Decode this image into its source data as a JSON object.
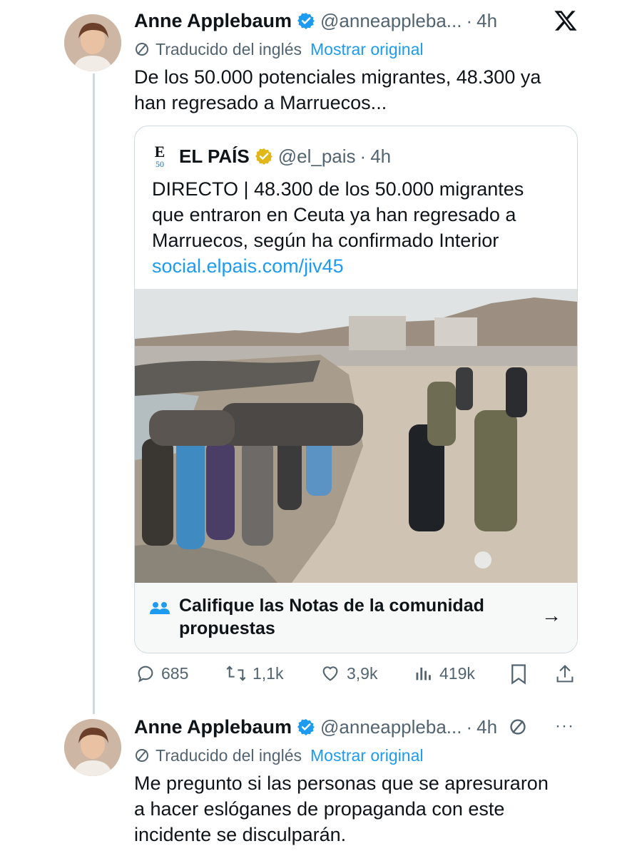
{
  "tweet1": {
    "author_name": "Anne Applebaum",
    "handle": "@anneappleba...",
    "separator": "·",
    "time": "4h",
    "translated_label": "Traducido del inglés",
    "show_original": "Mostrar original",
    "text_line1": "De los 50.000 potenciales migrantes, 48.300 ya",
    "text_line2": "han regresado a Marruecos...",
    "quote": {
      "logo_text": "E",
      "logo_sub": "50",
      "name": "EL PAÍS",
      "handle": "@el_pais",
      "separator": "·",
      "time": "4h",
      "text_line1": "DIRECTO | 48.300 de los 50.000 migrantes",
      "text_line2": "que entraron en Ceuta ya han regresado a",
      "text_line3": "Marruecos, según ha confirmado Interior",
      "link": "social.elpais.com/jiv45"
    },
    "community_notes": {
      "line1": "Califique las Notas de la comunidad",
      "line2": "propuestas",
      "arrow": "→"
    },
    "actions": {
      "replies": "685",
      "reposts": "1,1k",
      "likes": "3,9k",
      "views": "419k"
    }
  },
  "tweet2": {
    "author_name": "Anne Applebaum",
    "handle": "@anneappleba...",
    "separator": "·",
    "time": "4h",
    "more": "···",
    "translated_label": "Traducido del inglés",
    "show_original": "Mostrar original",
    "text_line1": "Me pregunto si las personas que se apresuraron",
    "text_line2": "a hacer eslóganes de propaganda con este",
    "text_line3": "incidente se disculparán."
  },
  "colors": {
    "accent_blue": "#1d9bf0",
    "verified_blue": "#1d9bf0",
    "verified_gold": "#e2b719",
    "secondary_text": "#536471",
    "border": "#cfd9de"
  }
}
